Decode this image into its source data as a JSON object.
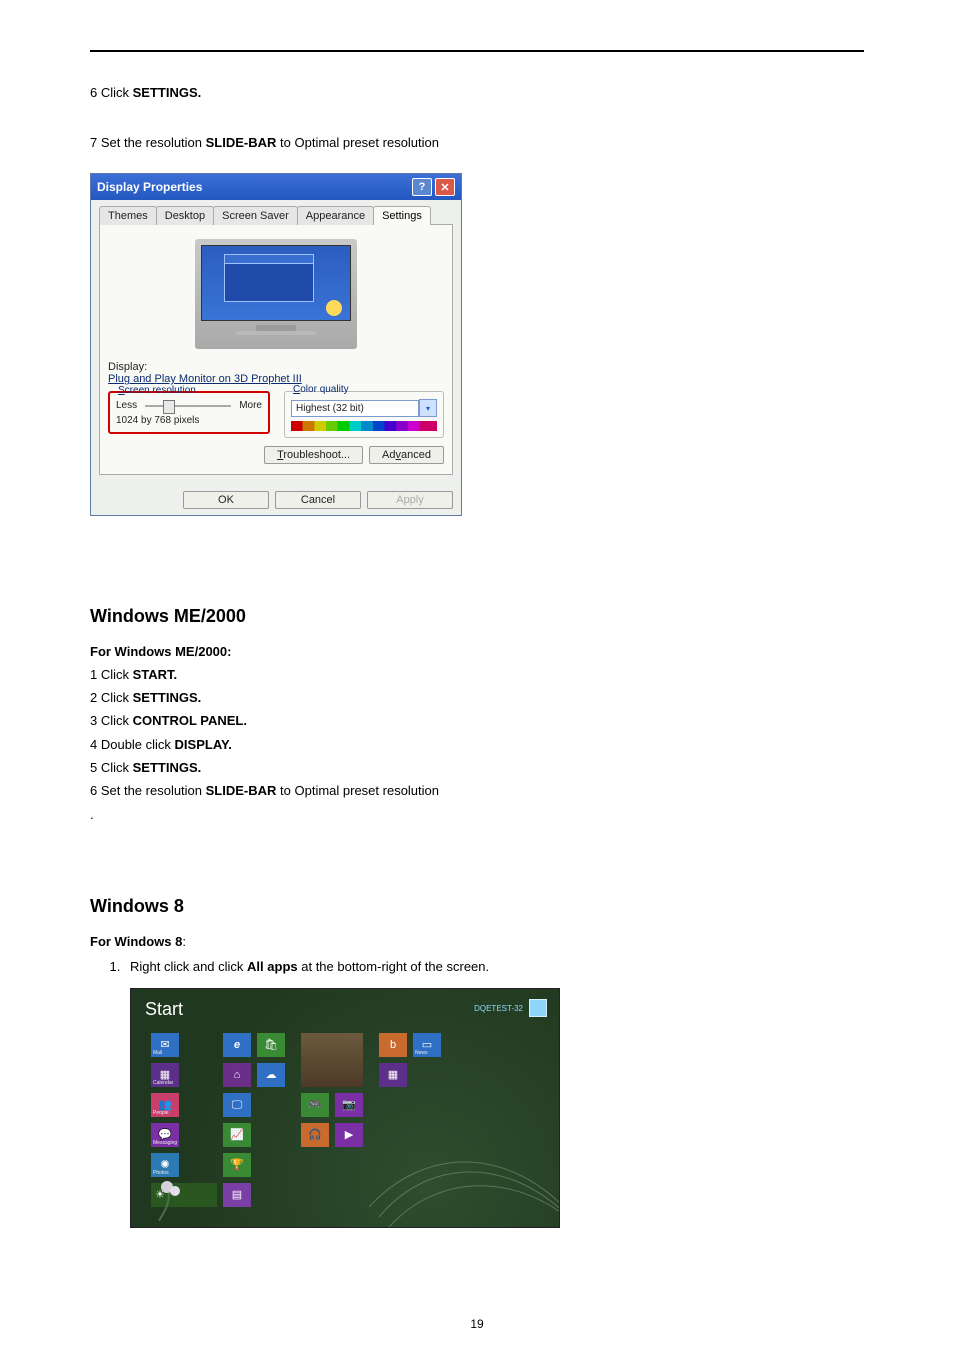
{
  "top": {
    "step6_prefix": "6 Click ",
    "step6_bold": "SETTINGS.",
    "step7_prefix": "7 Set the resolution ",
    "step7_bold": "SLIDE-BAR",
    "step7_suffix": " to Optimal preset resolution"
  },
  "dialog": {
    "title": "Display Properties",
    "help_icon": "?",
    "close_icon": "✕",
    "tabs": [
      "Themes",
      "Desktop",
      "Screen Saver",
      "Appearance",
      "Settings"
    ],
    "active_tab": "Settings",
    "display_label": "Display:",
    "display_value": "Plug and Play Monitor on 3D Prophet III",
    "screen_res_title": "Screen resolution",
    "less": "Less",
    "more": "More",
    "res_value": "1024 by 768 pixels",
    "color_quality_title": "Color quality",
    "color_quality_value": "Highest (32 bit)",
    "troubleshoot": "Troubleshoot...",
    "advanced": "Advanced",
    "ok": "OK",
    "cancel": "Cancel",
    "apply": "Apply"
  },
  "me2000": {
    "heading": "Windows ME/2000",
    "subhead": "For Windows ME/2000:",
    "s1_pre": "1 Click ",
    "s1_b": "START.",
    "s2_pre": "2 Click ",
    "s2_b": "SETTINGS.",
    "s3_pre": "3 Click ",
    "s3_b": "CONTROL PANEL.",
    "s4_pre": "4 Double click ",
    "s4_b": "DISPLAY.",
    "s5_pre": "5 Click ",
    "s5_b": "SETTINGS.",
    "s6_pre": "6 Set the resolution ",
    "s6_b": "SLIDE-BAR",
    "s6_suf": " to Optimal preset resolution",
    "dot": "."
  },
  "win8": {
    "heading": "Windows 8",
    "subhead": "For Windows 8",
    "subhead_colon": ":",
    "step1_pre": "Right click and click ",
    "step1_bold": "All apps",
    "step1_suf": " at the bottom-right of the screen.",
    "start_label": "Start",
    "user_label": "DQETEST-32",
    "tiles": {
      "mail": "Mail",
      "calendar": "Calendar",
      "people": "People",
      "messaging": "Messaging",
      "photos": "Photos",
      "weather": "Weather",
      "ie": "Internet Explorer",
      "store": "Store",
      "maps": "Maps",
      "skydrive": "SkyDrive",
      "desktop": "Desktop",
      "camera": "Camera",
      "music": "Music",
      "video": "Video",
      "finance": "Finance",
      "sports": "Sports",
      "news": "News",
      "games": "Games",
      "bing": "Bing",
      "reader": "Reader"
    }
  },
  "page_number": "19"
}
